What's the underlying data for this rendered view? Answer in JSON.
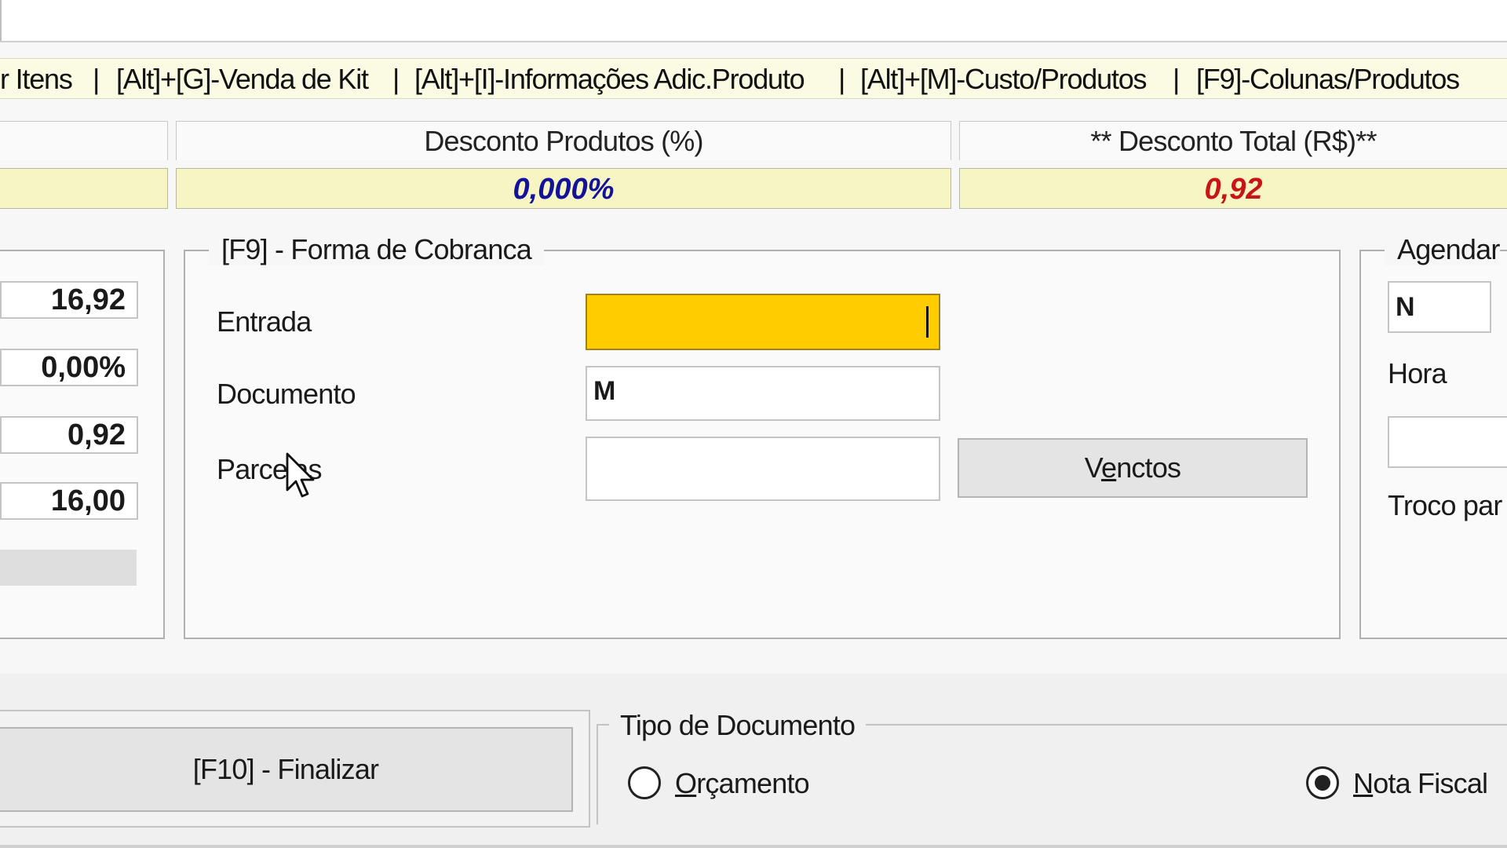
{
  "shortcuts": [
    "r Itens",
    "|",
    "[Alt]+[G]-Venda de Kit",
    "|",
    "[Alt]+[I]-Informações Adic.Produto",
    "|",
    "[Alt]+[M]-Custo/Produtos",
    "|",
    "[F9]-Colunas/Produtos"
  ],
  "totals": {
    "desconto_produtos_label": "Desconto Produtos (%)",
    "desconto_produtos_value": "0,000%",
    "desconto_total_label": "** Desconto Total (R$)**",
    "desconto_total_value": "0,92"
  },
  "summary_values": [
    "16,92",
    "0,00%",
    "0,92",
    "16,00"
  ],
  "cobranca": {
    "title": "[F9] - Forma de Cobranca",
    "entrada_label": "Entrada",
    "entrada_value": "",
    "documento_label": "Documento",
    "documento_value": "M",
    "parcelas_label": "Parcelas",
    "parcelas_value": "",
    "vinctos_button_prefix": "V",
    "vinctos_button_underline": "e",
    "vinctos_button_suffix": "nctos"
  },
  "agendar": {
    "title": "Agendar",
    "value": "N",
    "hora_label": "Hora",
    "troco_label": "Troco par"
  },
  "finalizar_button": "[F10]  -  Finalizar",
  "tipo_documento": {
    "title": "Tipo de Documento",
    "orcamento_underline": "O",
    "orcamento_rest": "rçamento",
    "nota_underline": "N",
    "nota_rest": "ota Fiscal",
    "selected": "Nota Fiscal"
  }
}
